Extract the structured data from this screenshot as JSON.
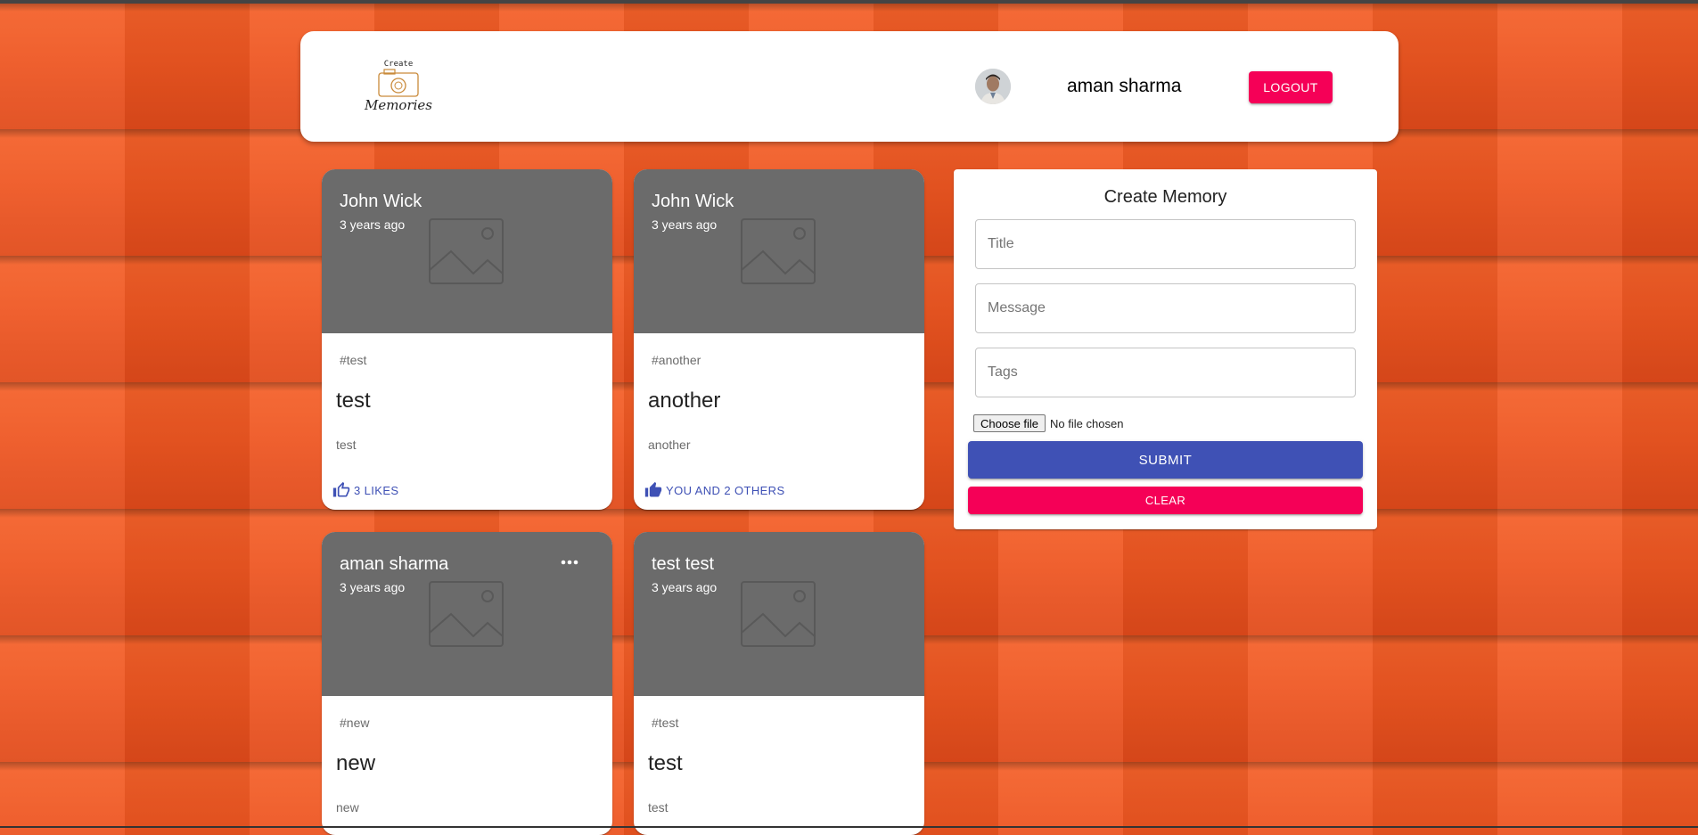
{
  "header": {
    "logo_text_top": "Create",
    "logo_text_bottom": "Memories",
    "user_name": "aman sharma",
    "logout_label": "LOGOUT"
  },
  "posts": [
    {
      "author": "John Wick",
      "time": "3 years ago",
      "tags": "#test",
      "title": "test",
      "message": "test",
      "likes": "3 LIKES",
      "liked_by_user": false,
      "has_menu": false
    },
    {
      "author": "John Wick",
      "time": "3 years ago",
      "tags": "#another",
      "title": "another",
      "message": "another",
      "likes": "YOU AND 2 OTHERS",
      "liked_by_user": true,
      "has_menu": false
    },
    {
      "author": "aman sharma",
      "time": "3 years ago",
      "tags": "#new",
      "title": "new",
      "message": "new",
      "has_menu": true
    },
    {
      "author": "test test",
      "time": "3 years ago",
      "tags": "#test",
      "title": "test",
      "message": "test",
      "has_menu": false
    }
  ],
  "form": {
    "heading": "Create Memory",
    "title_placeholder": "Title",
    "message_placeholder": "Message",
    "tags_placeholder": "Tags",
    "file_button": "Choose file",
    "file_status": "No file chosen",
    "submit_label": "SUBMIT",
    "clear_label": "CLEAR"
  },
  "colors": {
    "primary": "#3f51b5",
    "secondary": "#f50057",
    "card_media": "#6b6b6b",
    "background": "#e9501f"
  },
  "icons": [
    "logo-camera-icon",
    "avatar",
    "image-placeholder-icon",
    "thumb-up-outline-icon",
    "thumb-up-filled-icon",
    "more-horiz-icon"
  ]
}
